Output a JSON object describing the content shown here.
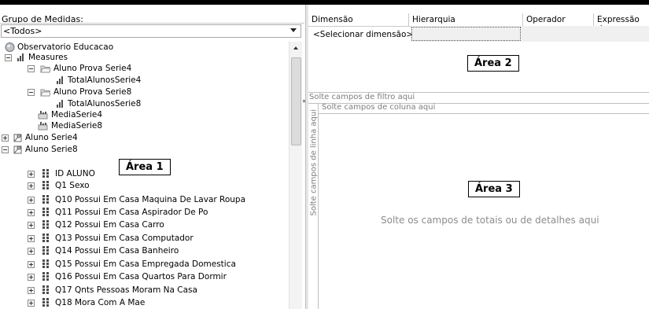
{
  "left": {
    "group_label": "Grupo de Medidas:",
    "group_select_value": "<Todos>",
    "annotation": "Área 1",
    "tree": [
      {
        "label": "Observatorio Educacao",
        "icon": "cube-icon"
      },
      {
        "label": "Measures",
        "icon": "measures-icon"
      },
      {
        "label": "Aluno Prova Serie4",
        "icon": "folder-icon"
      },
      {
        "label": "TotalAlunosSerie4",
        "icon": "measure-icon"
      },
      {
        "label": "Aluno Prova Serie8",
        "icon": "folder-icon"
      },
      {
        "label": "TotalAlunosSerie8",
        "icon": "measure-icon"
      },
      {
        "label": "MediaSerie4",
        "icon": "calculated-measure-icon"
      },
      {
        "label": "MediaSerie8",
        "icon": "calculated-measure-icon"
      },
      {
        "label": "Aluno Serie4",
        "icon": "dimension-icon"
      },
      {
        "label": "Aluno Serie8",
        "icon": "dimension-icon"
      },
      {
        "label": "ID ALUNO",
        "icon": "attribute-icon"
      },
      {
        "label": "Q1 Sexo",
        "icon": "attribute-icon"
      },
      {
        "label": "Q10 Possui Em Casa Maquina De Lavar Roupa",
        "icon": "attribute-icon"
      },
      {
        "label": "Q11 Possui Em Casa Aspirador De Po",
        "icon": "attribute-icon"
      },
      {
        "label": "Q12 Possui Em Casa Carro",
        "icon": "attribute-icon"
      },
      {
        "label": "Q13 Possui Em Casa Computador",
        "icon": "attribute-icon"
      },
      {
        "label": "Q14 Possui Em Casa Banheiro",
        "icon": "attribute-icon"
      },
      {
        "label": "Q15 Possui Em Casa Empregada Domestica",
        "icon": "attribute-icon"
      },
      {
        "label": "Q16 Possui Em Casa Quartos Para Dormir",
        "icon": "attribute-icon"
      },
      {
        "label": "Q17 Qnts Pessoas Moram Na Casa",
        "icon": "attribute-icon"
      },
      {
        "label": "Q18 Mora Com A Mae",
        "icon": "attribute-icon"
      }
    ]
  },
  "right": {
    "columns": [
      "Dimensão",
      "Hierarquia",
      "Operador",
      "Expressão de"
    ],
    "select_dimension": "<Selecionar dimensão>",
    "annotation2": "Área 2",
    "filter_drop": "Solte campos de filtro aqui",
    "column_drop": "Solte campos de coluna aqui",
    "row_drop": "Solte campos de linha aqui",
    "annotation3": "Área 3",
    "totals_drop": "Solte os campos de totais ou de detalhes aqui"
  }
}
